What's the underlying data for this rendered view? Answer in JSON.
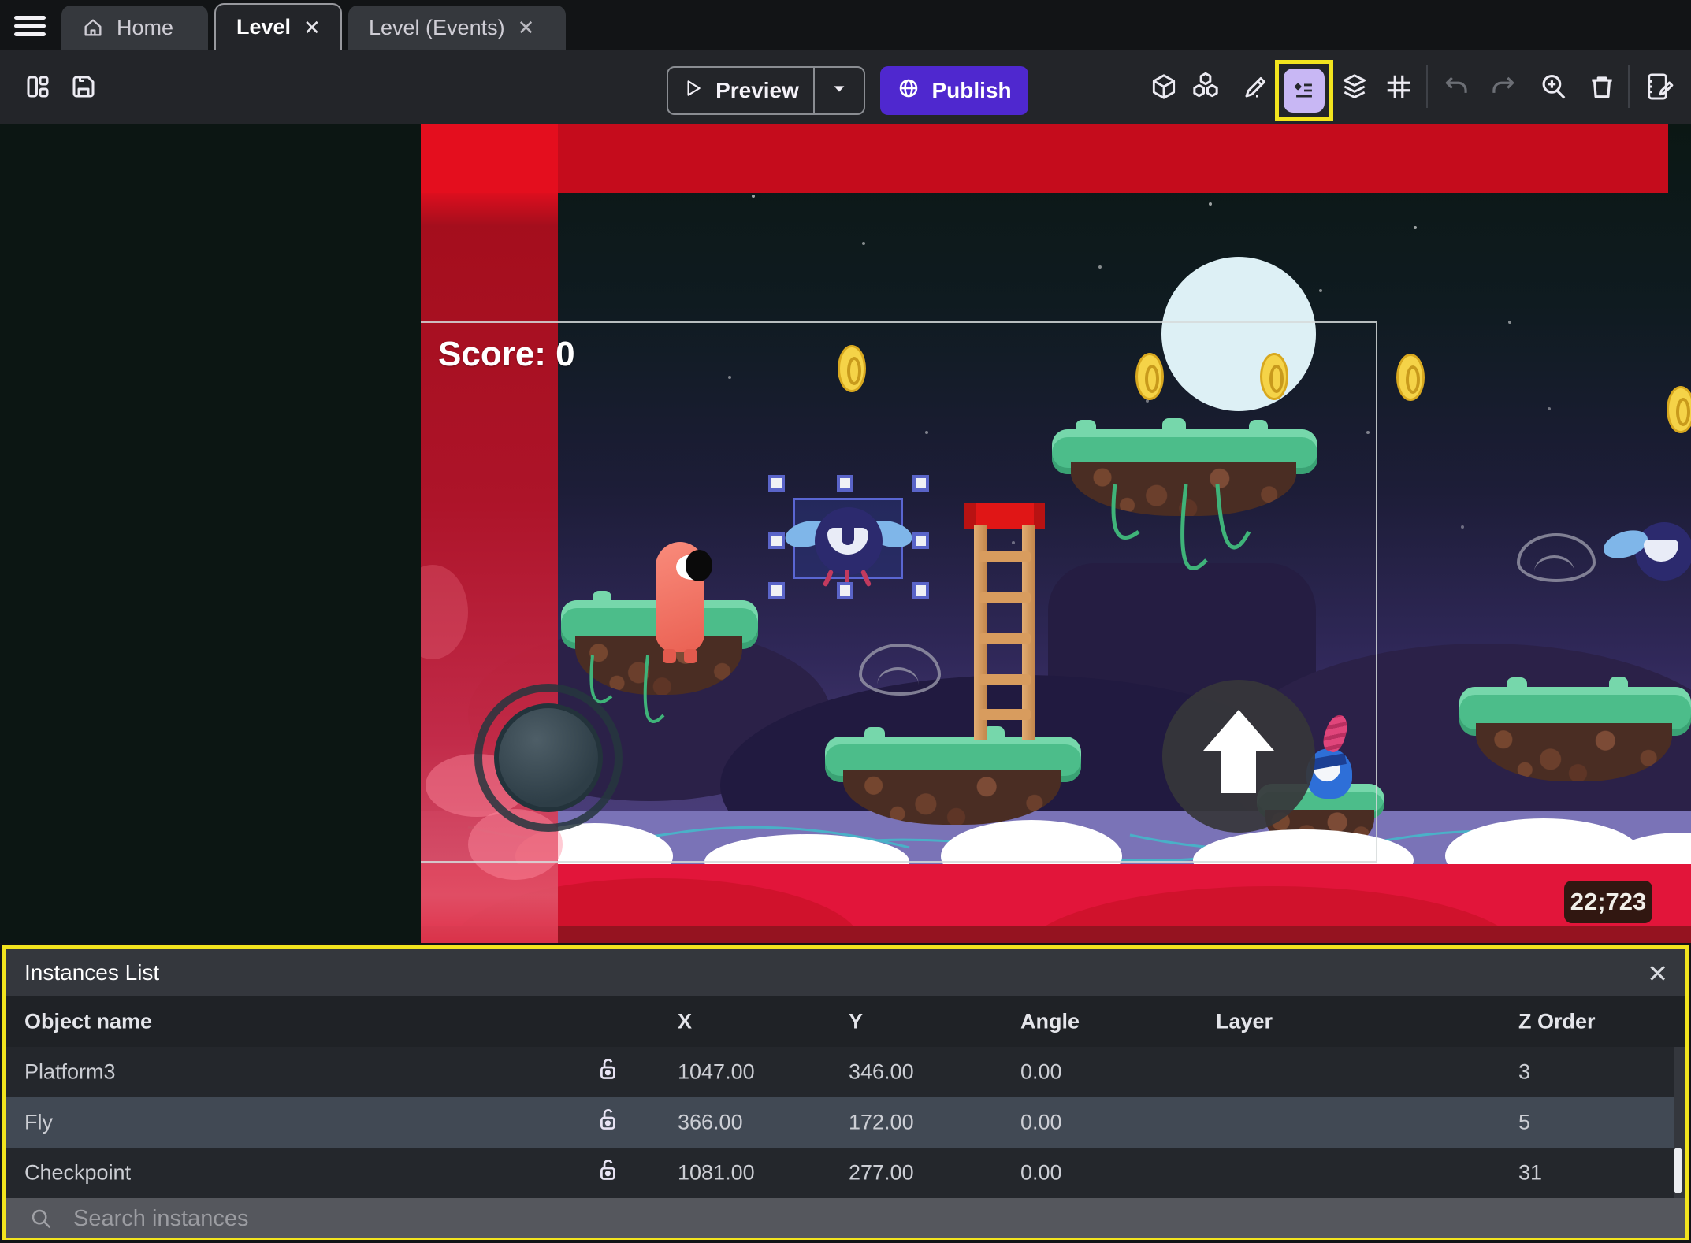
{
  "tabs": {
    "home": "Home",
    "level": "Level",
    "level_events": "Level (Events)"
  },
  "toolbar": {
    "preview": "Preview",
    "publish": "Publish"
  },
  "canvas": {
    "score": "Score: 0",
    "badge": "22;723"
  },
  "instances_panel": {
    "title": "Instances List",
    "columns": [
      "Object name",
      "X",
      "Y",
      "Angle",
      "Layer",
      "Z Order"
    ],
    "rows": [
      {
        "name": "Platform3",
        "x": "1047.00",
        "y": "346.00",
        "angle": "0.00",
        "layer": "",
        "z": "3"
      },
      {
        "name": "Fly",
        "x": "366.00",
        "y": "172.00",
        "angle": "0.00",
        "layer": "",
        "z": "5"
      },
      {
        "name": "Checkpoint",
        "x": "1081.00",
        "y": "277.00",
        "angle": "0.00",
        "layer": "",
        "z": "31"
      }
    ],
    "search_placeholder": "Search instances"
  },
  "colors": {
    "publish_purple": "#4f28cf",
    "highlight_yellow": "#f2e41e",
    "selected_row": "#414954",
    "canvas_red_band": "#c50c1c",
    "selection_blue": "#5a66d2"
  }
}
